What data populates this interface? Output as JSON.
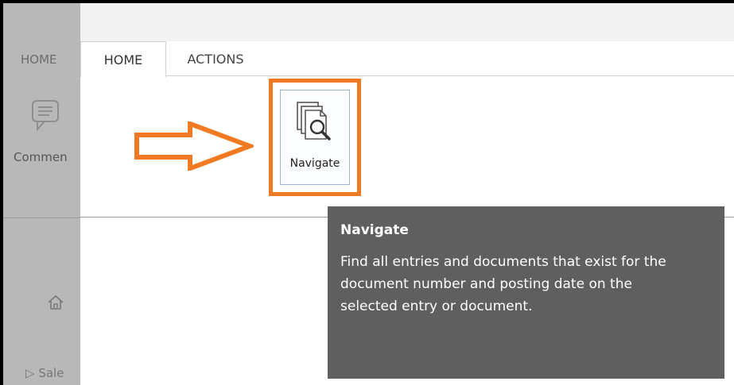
{
  "background_panel": {
    "tab_label": "HOME",
    "comment_label": "Commen",
    "sales_label": "Sale"
  },
  "ribbon": {
    "tabs": [
      {
        "label": "HOME",
        "active": true
      },
      {
        "label": "ACTIONS",
        "active": false
      }
    ],
    "navigate_button": {
      "label": "Navigate",
      "icon": "navigate-search-icon"
    }
  },
  "tooltip": {
    "title": "Navigate",
    "description": "Find all entries and documents that exist for the document number and posting date on the selected entry or document."
  },
  "colors": {
    "highlight": "#f07a21",
    "tooltip_bg": "#5f5f5f"
  }
}
